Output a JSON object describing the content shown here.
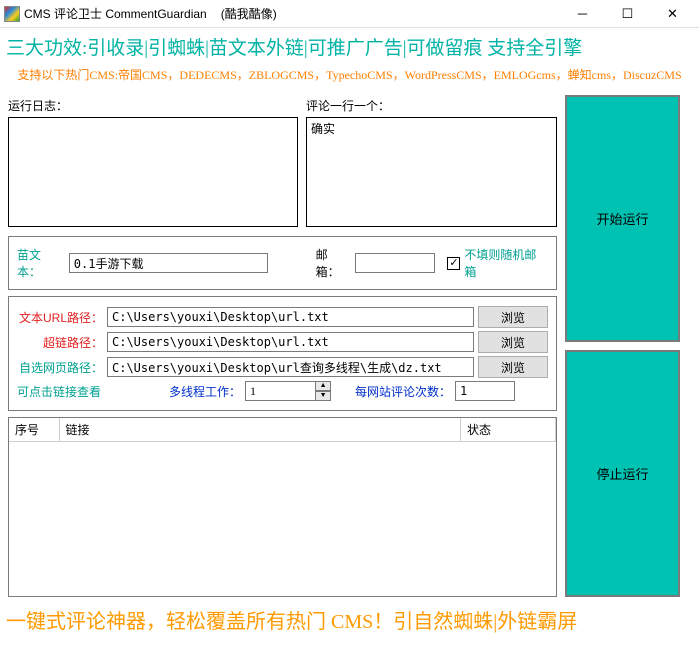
{
  "window": {
    "title": "CMS 评论卫士 CommentGuardian",
    "subtitle": "(酷我酷像)"
  },
  "banner1": "三大功效:引收录|引蜘蛛|苗文本外链|可推广广告|可做留痕 支持全引擎",
  "banner2": "支持以下热门CMS:帝国CMS，DEDECMS，ZBLOGCMS，TypechoCMS，WordPressCMS，EMLOGcms，蝉知cms，DiscuzCMS",
  "labels": {
    "log": "运行日志：",
    "comment": "评论一行一个：",
    "anchor": "苗文本：",
    "email": "邮箱：",
    "random_email": "不填则随机邮箱",
    "path_text": "文本URL路径：",
    "path_link": "超链路径：",
    "path_custom": "自选网页路径：",
    "click_hint": "可点击链接查看",
    "threads": "多线程工作：",
    "per_site": "每网站评论次数：",
    "browse": "浏览",
    "col_no": "序号",
    "col_link": "链接",
    "col_status": "状态",
    "start": "开始运行",
    "stop": "停止运行"
  },
  "values": {
    "comment_text": "确实",
    "anchor_text": "0.1手游下载",
    "email": "",
    "random_email_checked": true,
    "path_text": "C:\\Users\\youxi\\Desktop\\url.txt",
    "path_link": "C:\\Users\\youxi\\Desktop\\url.txt",
    "path_custom": "C:\\Users\\youxi\\Desktop\\url查询多线程\\生成\\dz.txt",
    "threads": "1",
    "per_site": "1"
  },
  "footer": "一键式评论神器，轻松覆盖所有热门 CMS！引自然蜘蛛|外链霸屏"
}
